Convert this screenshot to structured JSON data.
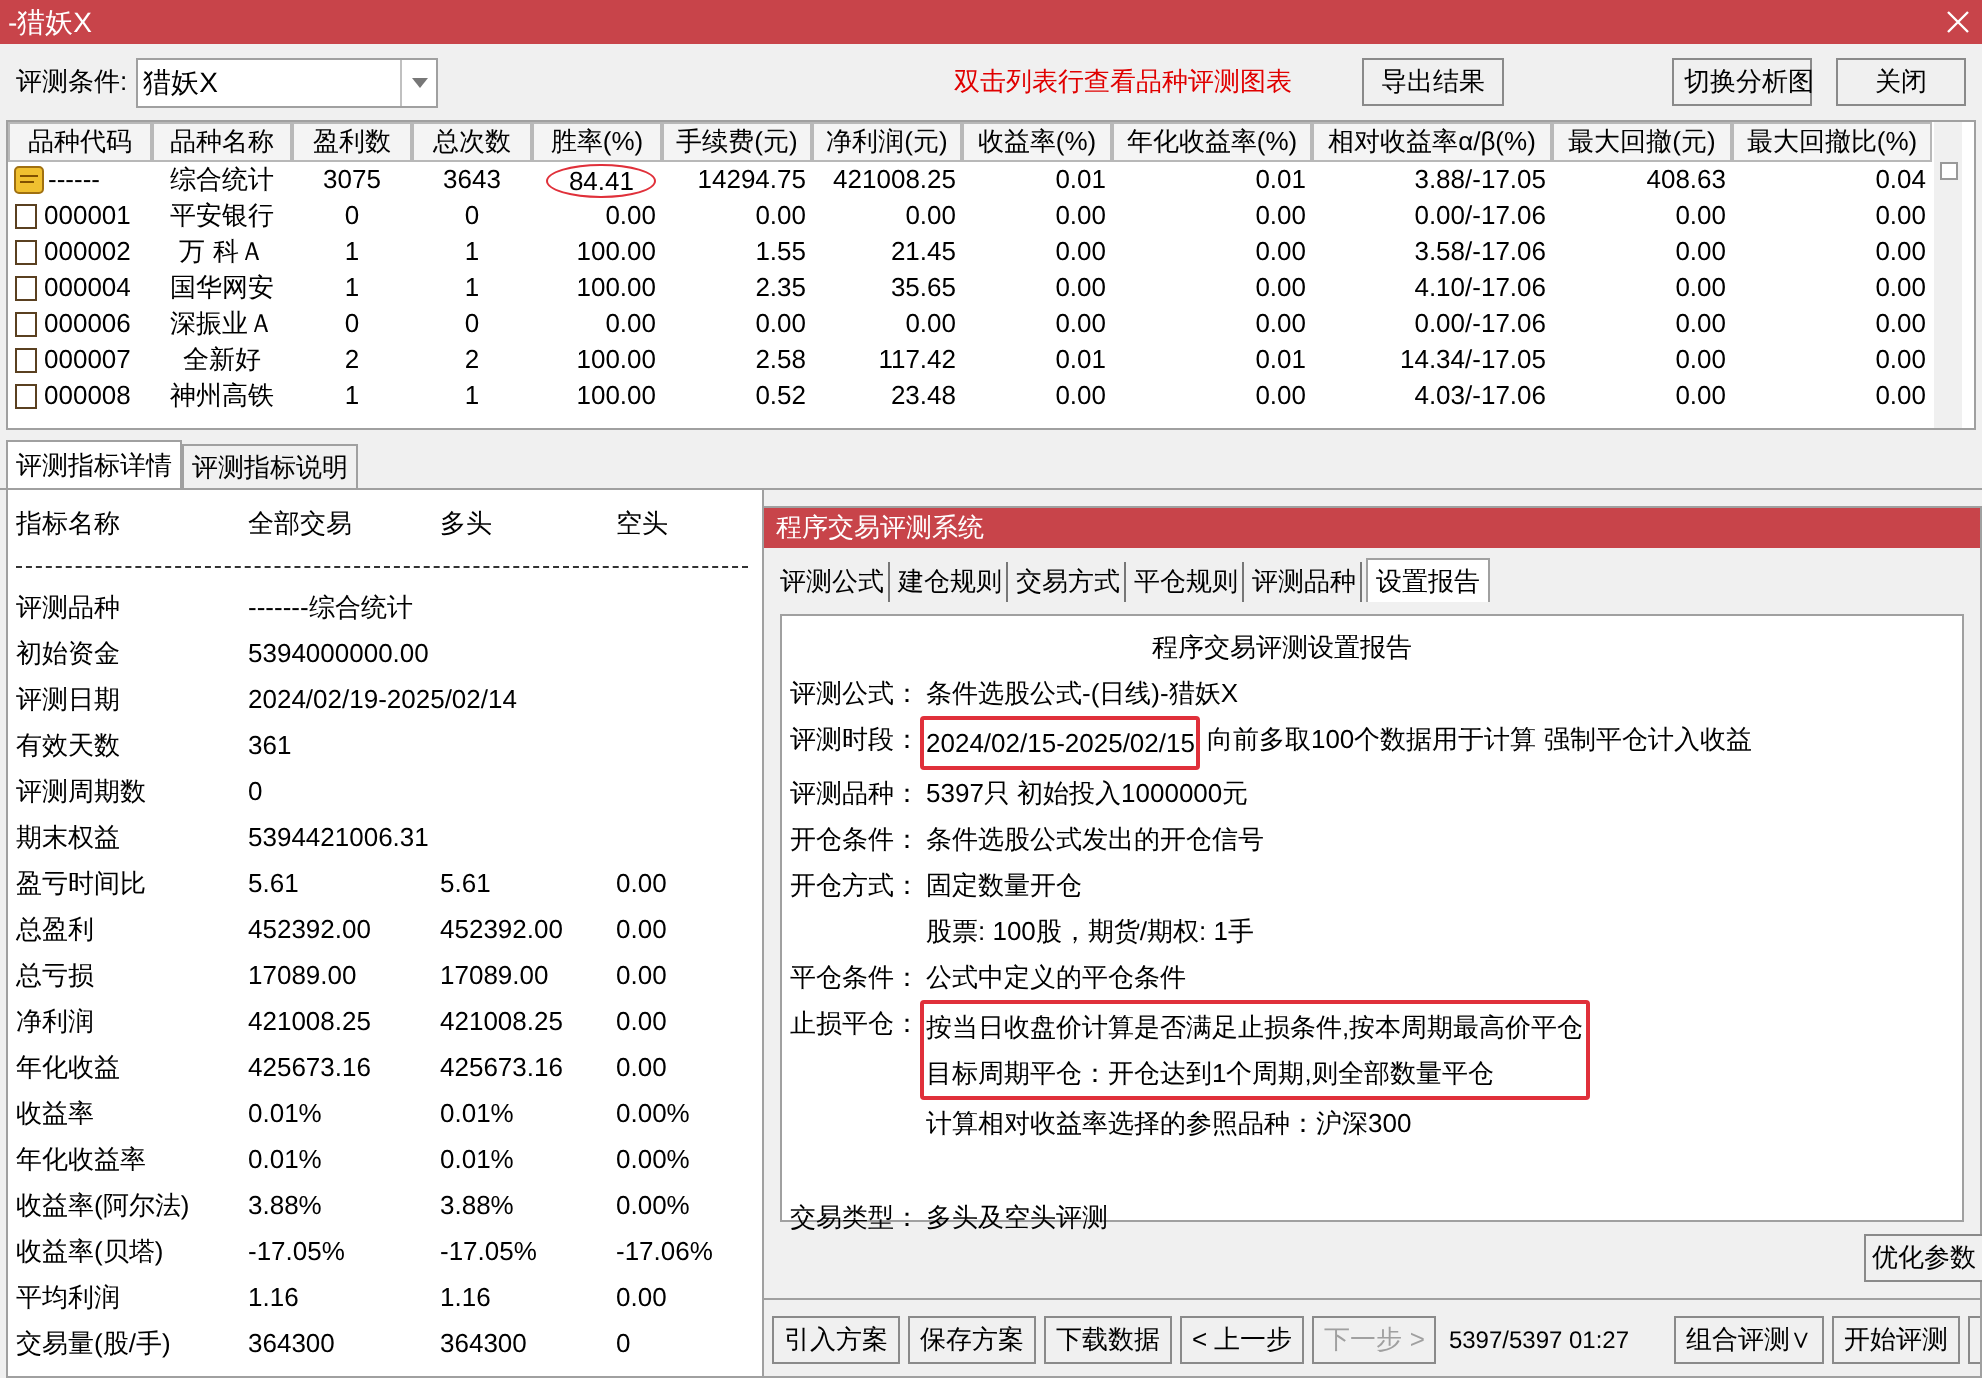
{
  "window": {
    "title": "-猎妖X"
  },
  "toolbar": {
    "condition_label": "评测条件:",
    "condition_value": "猎妖X",
    "hint": "双击列表行查看品种评测图表",
    "buttons": [
      "导出结果",
      "切换分析图",
      "关闭"
    ]
  },
  "table": {
    "columns": [
      "品种代码",
      "品种名称",
      "盈利数",
      "总次数",
      "胜率(%)",
      "手续费(元)",
      "净利润(元)",
      "收益率(%)",
      "年化收益率(%)",
      "相对收益率α/β(%)",
      "最大回撤(元)",
      "最大回撤比(%)"
    ],
    "rows": [
      {
        "kind": "summary",
        "circled": true,
        "cells": [
          "------",
          "综合统计",
          "3075",
          "3643",
          "84.41",
          "14294.75",
          "421008.25",
          "0.01",
          "0.01",
          "3.88/-17.05",
          "408.63",
          "0.04"
        ]
      },
      {
        "kind": "stock",
        "circled": false,
        "cells": [
          "000001",
          "平安银行",
          "0",
          "0",
          "0.00",
          "0.00",
          "0.00",
          "0.00",
          "0.00",
          "0.00/-17.06",
          "0.00",
          "0.00"
        ]
      },
      {
        "kind": "stock",
        "circled": false,
        "cells": [
          "000002",
          "万 科Ａ",
          "1",
          "1",
          "100.00",
          "1.55",
          "21.45",
          "0.00",
          "0.00",
          "3.58/-17.06",
          "0.00",
          "0.00"
        ]
      },
      {
        "kind": "stock",
        "circled": false,
        "cells": [
          "000004",
          "国华网安",
          "1",
          "1",
          "100.00",
          "2.35",
          "35.65",
          "0.00",
          "0.00",
          "4.10/-17.06",
          "0.00",
          "0.00"
        ]
      },
      {
        "kind": "stock",
        "circled": false,
        "cells": [
          "000006",
          "深振业Ａ",
          "0",
          "0",
          "0.00",
          "0.00",
          "0.00",
          "0.00",
          "0.00",
          "0.00/-17.06",
          "0.00",
          "0.00"
        ]
      },
      {
        "kind": "stock",
        "circled": false,
        "cells": [
          "000007",
          "全新好",
          "2",
          "2",
          "100.00",
          "2.58",
          "117.42",
          "0.01",
          "0.01",
          "14.34/-17.05",
          "0.00",
          "0.00"
        ]
      },
      {
        "kind": "stock",
        "circled": false,
        "cells": [
          "000008",
          "神州高铁",
          "1",
          "1",
          "100.00",
          "0.52",
          "23.48",
          "0.00",
          "0.00",
          "4.03/-17.06",
          "0.00",
          "0.00"
        ]
      }
    ]
  },
  "bottom_tabs": [
    {
      "label": "评测指标详情",
      "selected": true
    },
    {
      "label": "评测指标说明",
      "selected": false
    }
  ],
  "metrics": {
    "columns": [
      "指标名称",
      "全部交易",
      "多头",
      "空头"
    ],
    "rows": [
      {
        "name": "评测品种",
        "values": [
          "-------综合统计"
        ]
      },
      {
        "name": "初始资金",
        "values": [
          "5394000000.00"
        ]
      },
      {
        "name": "评测日期",
        "values": [
          "2024/02/19-2025/02/14"
        ]
      },
      {
        "name": "有效天数",
        "values": [
          "361"
        ]
      },
      {
        "name": "评测周期数",
        "values": [
          "0"
        ]
      },
      {
        "name": "期末权益",
        "values": [
          "5394421006.31"
        ]
      },
      {
        "name": "盈亏时间比",
        "values": [
          "5.61",
          "5.61",
          "0.00"
        ]
      },
      {
        "name": "总盈利",
        "values": [
          "452392.00",
          "452392.00",
          "0.00"
        ]
      },
      {
        "name": "总亏损",
        "values": [
          "17089.00",
          "17089.00",
          "0.00"
        ]
      },
      {
        "name": "净利润",
        "values": [
          "421008.25",
          "421008.25",
          "0.00"
        ]
      },
      {
        "name": "年化收益",
        "values": [
          "425673.16",
          "425673.16",
          "0.00"
        ]
      },
      {
        "name": "收益率",
        "values": [
          "0.01%",
          "0.01%",
          "0.00%"
        ]
      },
      {
        "name": "年化收益率",
        "values": [
          "0.01%",
          "0.01%",
          "0.00%"
        ]
      },
      {
        "name": "收益率(阿尔法)",
        "values": [
          "3.88%",
          "3.88%",
          "0.00%"
        ]
      },
      {
        "name": "收益率(贝塔)",
        "values": [
          "-17.05%",
          "-17.05%",
          "-17.06%"
        ]
      },
      {
        "name": "平均利润",
        "values": [
          "1.16",
          "1.16",
          "0.00"
        ]
      },
      {
        "name": "交易量(股/手)",
        "values": [
          "364300",
          "364300",
          "0"
        ]
      }
    ]
  },
  "dialog": {
    "title": "程序交易评测系统",
    "tabs": [
      {
        "label": "评测公式",
        "selected": false
      },
      {
        "label": "建仓规则",
        "selected": false
      },
      {
        "label": "交易方式",
        "selected": false
      },
      {
        "label": "平仓规则",
        "selected": false
      },
      {
        "label": "评测品种",
        "selected": false
      },
      {
        "label": "设置报告",
        "selected": true
      }
    ],
    "report_title": "程序交易评测设置报告",
    "report": [
      {
        "label": "评测公式：",
        "lines": [
          "条件选股公式-(日线)-猎妖X"
        ],
        "boxed": false
      },
      {
        "label": "评测时段：",
        "lines": [
          "2024/02/15-2025/02/15"
        ],
        "boxed": true,
        "after": "向前多取100个数据用于计算 强制平仓计入收益"
      },
      {
        "label": "评测品种：",
        "lines": [
          "5397只 初始投入1000000元"
        ],
        "boxed": false
      },
      {
        "label": "开仓条件：",
        "lines": [
          "条件选股公式发出的开仓信号"
        ],
        "boxed": false
      },
      {
        "label": "开仓方式：",
        "lines": [
          "固定数量开仓",
          "股票: 100股，期货/期权: 1手"
        ],
        "boxed": false
      },
      {
        "label": "平仓条件：",
        "lines": [
          "公式中定义的平仓条件"
        ],
        "boxed": false
      },
      {
        "label": "止损平仓：",
        "lines": [
          "按当日收盘价计算是否满足止损条件,按本周期最高价平仓",
          "目标周期平仓：开仓达到1个周期,则全部数量平仓"
        ],
        "boxed": true
      },
      {
        "lines": [
          "计算相对收益率选择的参照品种：沪深300"
        ],
        "boxed": false
      }
    ],
    "trade_type": {
      "label": "交易类型：",
      "lines": [
        "多头及空头评测"
      ],
      "boxed": false
    },
    "optimize_button": "优化参数",
    "buttons": [
      {
        "label": "引入方案",
        "disabled": false
      },
      {
        "label": "保存方案",
        "disabled": false
      },
      {
        "label": "下载数据",
        "disabled": false
      },
      {
        "label": "< 上一步",
        "disabled": false
      },
      {
        "label": "下一步 >",
        "disabled": true
      }
    ],
    "progress": "5397/5397 01:27",
    "right_buttons": [
      "组合评测∨",
      "开始评测"
    ]
  }
}
